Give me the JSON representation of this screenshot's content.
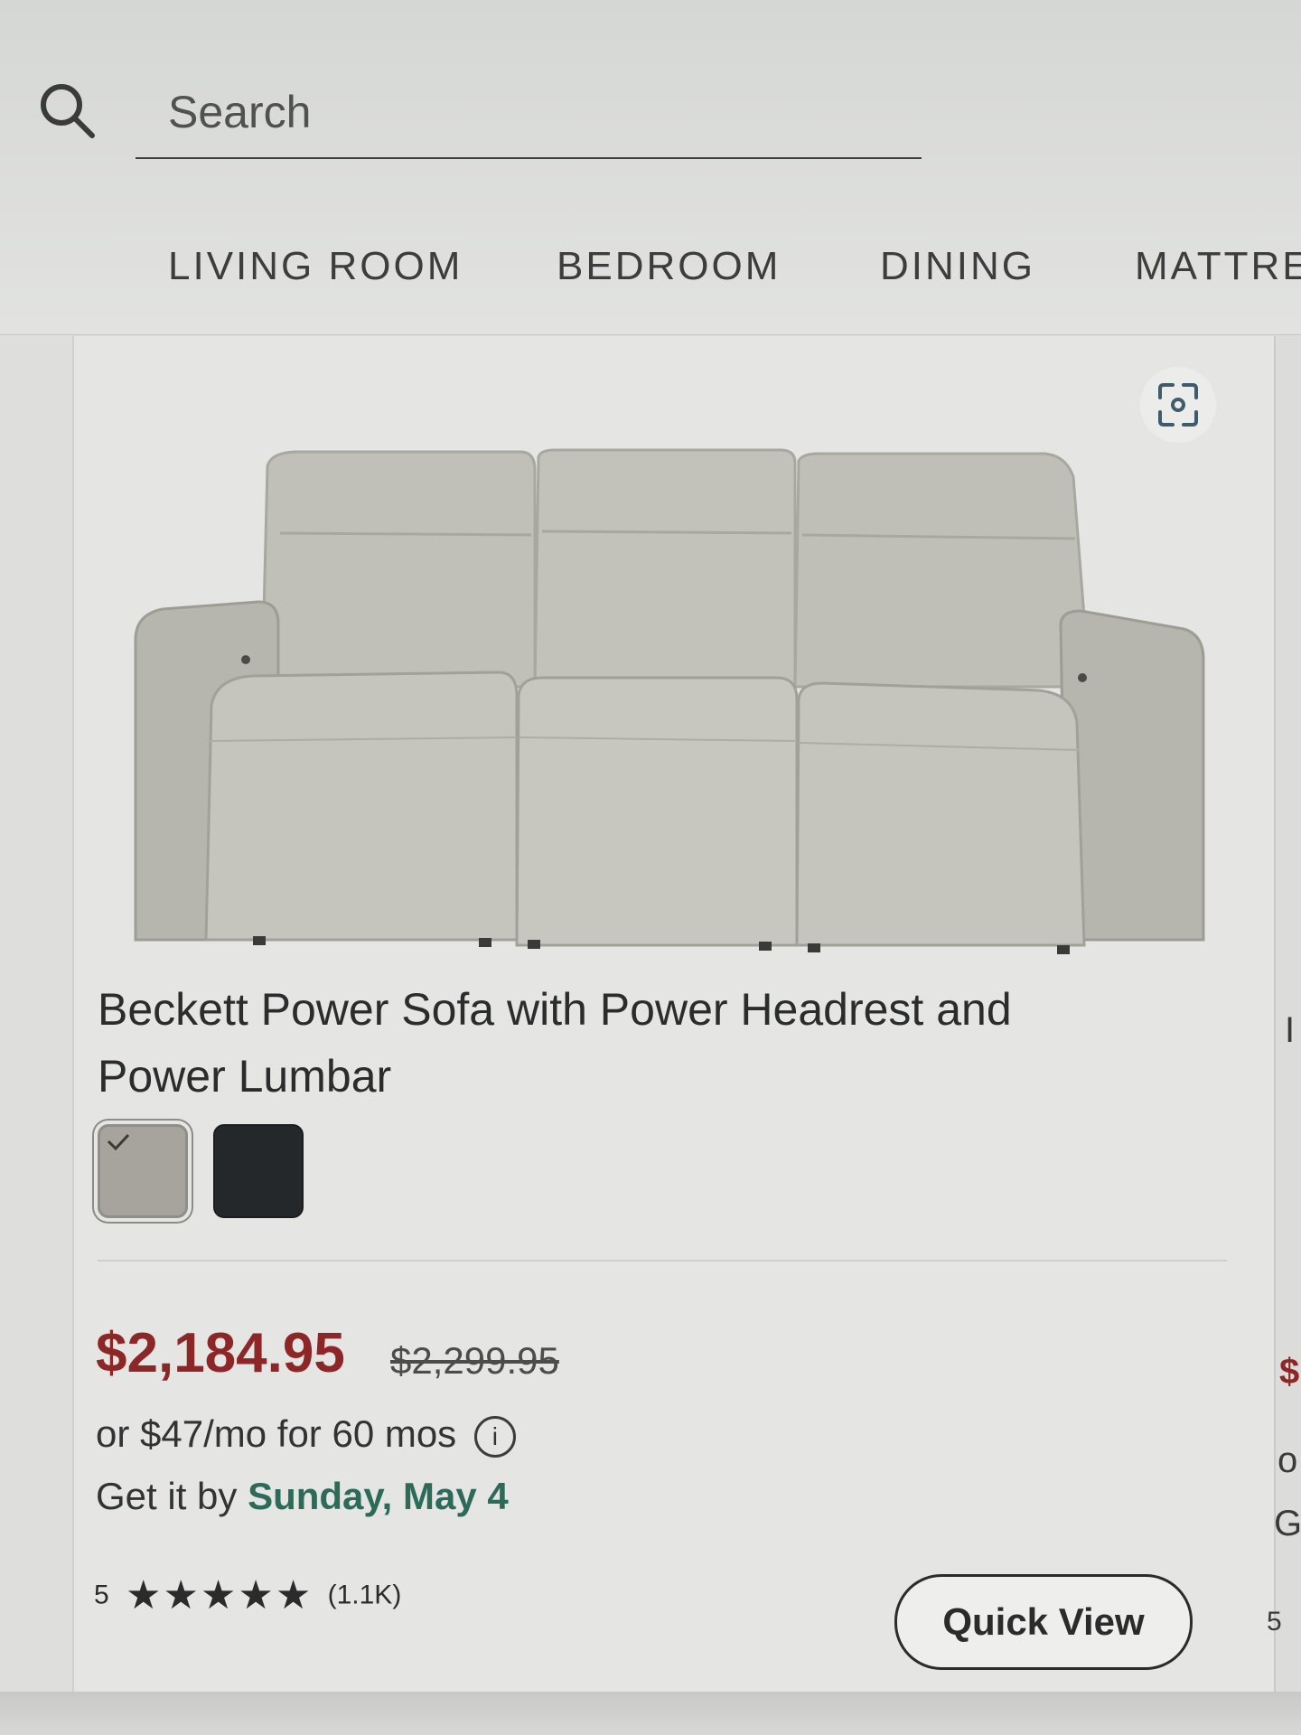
{
  "search": {
    "placeholder": "Search"
  },
  "nav": {
    "items": [
      {
        "label": "LIVING ROOM"
      },
      {
        "label": "BEDROOM"
      },
      {
        "label": "DINING"
      },
      {
        "label": "MATTRE"
      }
    ]
  },
  "product": {
    "title": "Beckett Power Sofa with Power Headrest and Power Lumbar",
    "swatches": [
      {
        "color": "#a6a49c",
        "selected": true
      },
      {
        "color": "#25282a",
        "selected": false
      }
    ],
    "sale_price": "$2,184.95",
    "original_price": "$2,299.95",
    "financing": "or $47/mo for 60 mos",
    "info_glyph": "i",
    "delivery_prefix": "Get it by",
    "delivery_date": "Sunday, May 4",
    "rating_score": "5",
    "stars": "★★★★★",
    "rating_count": "(1.1K)",
    "quick_view_label": "Quick View",
    "sale_color": "#8d2727",
    "delivery_color": "#2c6a5a"
  },
  "next_card_peek": {
    "title_char": "I",
    "price_char": "$",
    "financing_char": "o",
    "delivery_char": "G",
    "rating_char": "5"
  }
}
